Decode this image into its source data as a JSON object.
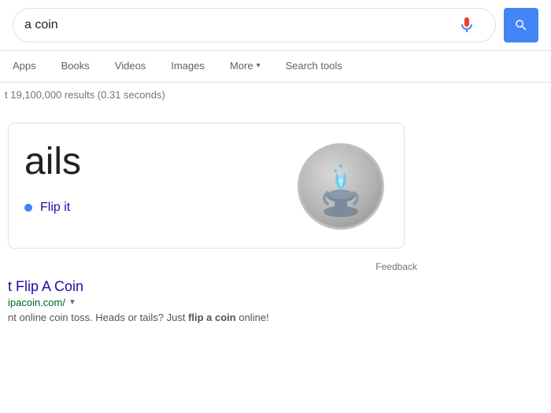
{
  "search": {
    "query": "a coin",
    "placeholder": "Search",
    "mic_label": "microphone",
    "search_button_label": "search"
  },
  "nav": {
    "tabs": [
      {
        "id": "apps",
        "label": "Apps",
        "active": false
      },
      {
        "id": "books",
        "label": "Books",
        "active": false
      },
      {
        "id": "videos",
        "label": "Videos",
        "active": false
      },
      {
        "id": "images",
        "label": "Images",
        "active": false
      },
      {
        "id": "more",
        "label": "More",
        "active": false,
        "has_dropdown": true
      },
      {
        "id": "search-tools",
        "label": "Search tools",
        "active": false
      }
    ]
  },
  "results": {
    "count_text": "t 19,100,000 results (0.31 seconds)"
  },
  "coin_widget": {
    "result_text": "ails",
    "flip_link_label": "Flip it",
    "feedback_label": "Feedback"
  },
  "search_result": {
    "title": "t Flip A Coin",
    "url": "ipacoin.com/",
    "url_dropdown": "▼",
    "snippet_before": "nt online coin toss. Heads or tails? Just ",
    "snippet_bold": "flip a coin",
    "snippet_after": " online!"
  },
  "colors": {
    "accent_blue": "#4285f4",
    "link_blue": "#1a0dab",
    "green_url": "#006621",
    "text_gray": "#70757a"
  }
}
